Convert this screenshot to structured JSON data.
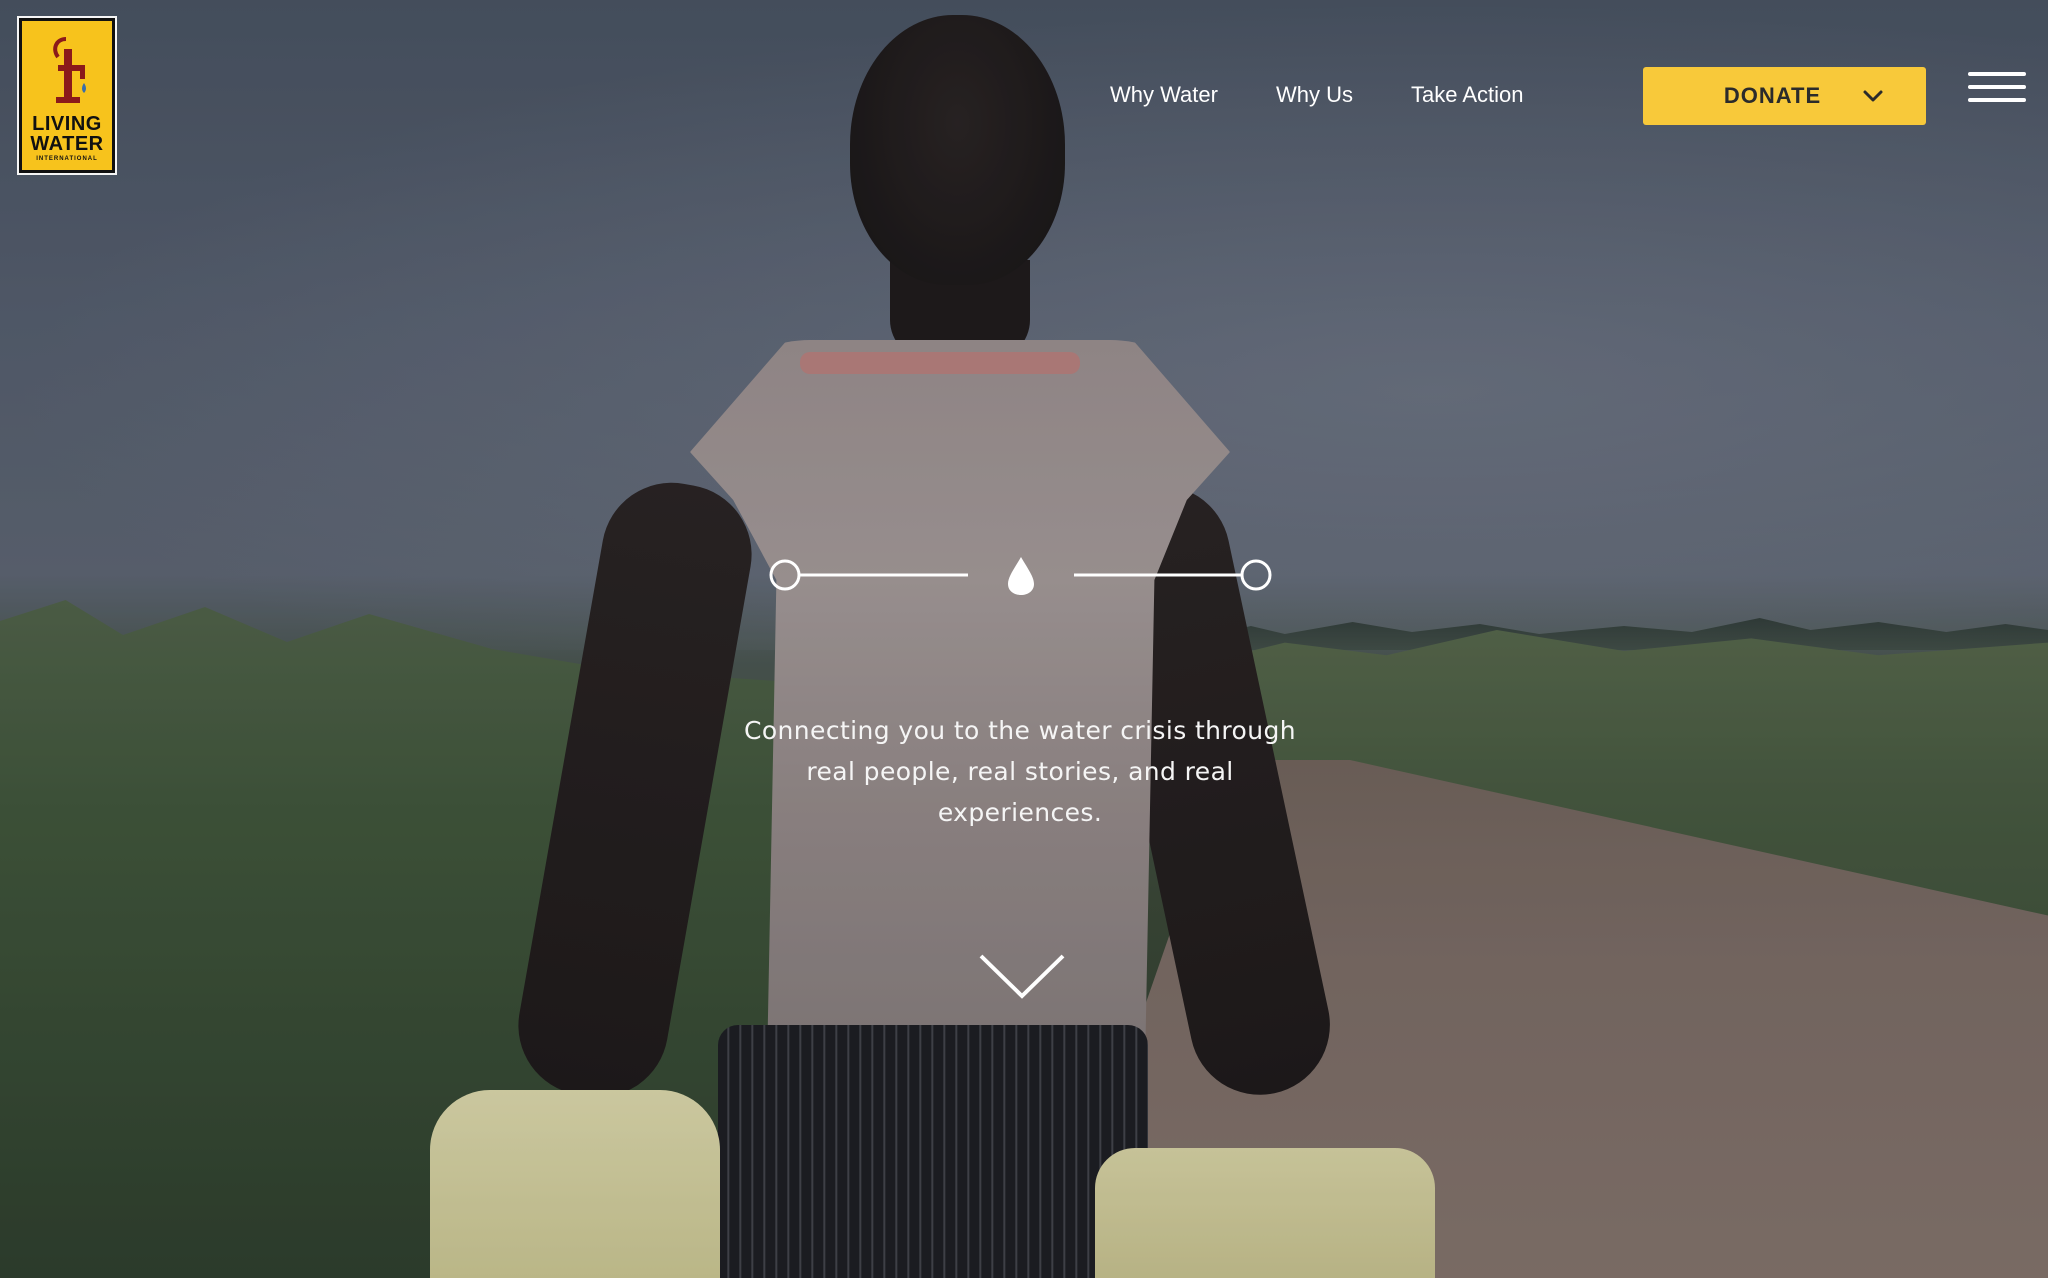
{
  "logo": {
    "line1": "LIVING",
    "line2": "WATER",
    "line3": "INTERNATIONAL",
    "background": "#f7c31c"
  },
  "nav": {
    "items": [
      {
        "label": "Why Water"
      },
      {
        "label": "Why Us"
      },
      {
        "label": "Take Action"
      }
    ],
    "donate_label": "DONATE",
    "donate_color": "#f8c93a"
  },
  "hero": {
    "tagline": "Connecting you to the water crisis through real people, real stories, and real experiences.",
    "icons": [
      "water-drop-icon",
      "chevron-down-icon",
      "hamburger-menu-icon"
    ]
  }
}
